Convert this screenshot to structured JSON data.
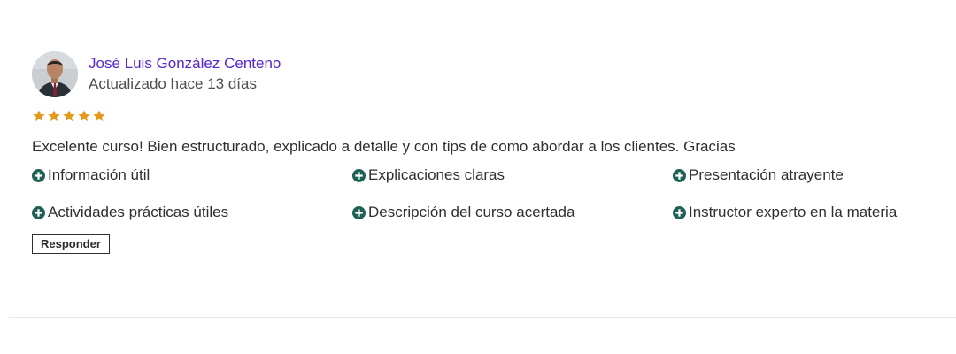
{
  "review": {
    "author": "José Luis González Centeno",
    "updated": "Actualizado hace 13 días",
    "rating": 5,
    "star_color": "#e59819",
    "comment": "Excelente curso! Bien estructurado, explicado a detalle y con tips de como abordar a los clientes. Gracias",
    "tags": [
      {
        "label": "Información útil",
        "icon": "plus-circle-icon"
      },
      {
        "label": "Explicaciones claras",
        "icon": "plus-circle-icon"
      },
      {
        "label": "Presentación atrayente",
        "icon": "plus-circle-icon"
      },
      {
        "label": "Actividades prácticas útiles",
        "icon": "plus-circle-icon"
      },
      {
        "label": "Descripción del curso acertada",
        "icon": "plus-circle-icon"
      },
      {
        "label": "Instructor experto en la materia",
        "icon": "plus-circle-icon"
      }
    ],
    "tag_icon_color": "#1e6055",
    "reply_label": "Responder"
  },
  "colors": {
    "author_link": "#5624d0",
    "text": "#2d2f31",
    "divider": "#e4e6e8"
  }
}
